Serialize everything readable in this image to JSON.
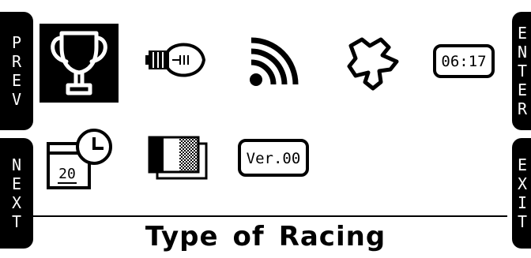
{
  "side_tabs": {
    "prev": [
      "P",
      "R",
      "E",
      "V"
    ],
    "next": [
      "N",
      "E",
      "X",
      "T"
    ],
    "enter": [
      "E",
      "N",
      "T",
      "E",
      "R"
    ],
    "exit": [
      "E",
      "X",
      "I",
      "T"
    ]
  },
  "icons": {
    "trophy": "trophy-icon",
    "lamp": "lamp-icon",
    "signal": "signal-icon",
    "track": "track-map-icon",
    "time_display": {
      "icon": "clock-display-icon",
      "text": "06:17"
    },
    "calendar": {
      "icon": "calendar-clock-icon",
      "day": "20"
    },
    "contrast": "contrast-icon",
    "version": {
      "icon": "version-icon",
      "text": "Ver.00"
    }
  },
  "selected_icon": "trophy",
  "title_words": [
    "Type",
    "of",
    "Racing"
  ],
  "colors": {
    "foreground": "#000000",
    "background": "#ffffff"
  }
}
